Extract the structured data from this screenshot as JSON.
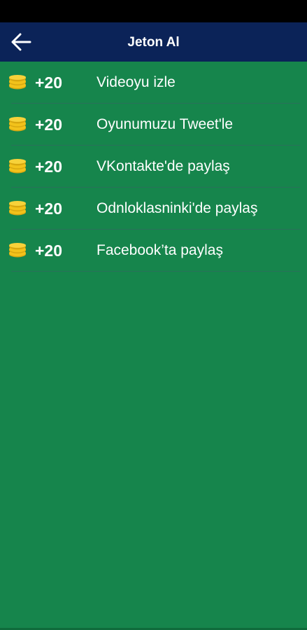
{
  "app_bar": {
    "title": "Jeton Al",
    "back_icon": "arrow-left-icon"
  },
  "rewards": [
    {
      "amount": "+20",
      "label": "Videoyu izle",
      "icon": "coin-stack-icon"
    },
    {
      "amount": "+20",
      "label": "Oyunumuzu Tweet'le",
      "icon": "coin-stack-icon"
    },
    {
      "amount": "+20",
      "label": "VKontakte'de paylaş",
      "icon": "coin-stack-icon"
    },
    {
      "amount": "+20",
      "label": "Odnloklasninki'de paylaş",
      "icon": "coin-stack-icon"
    },
    {
      "amount": "+20",
      "label": "Facebook’ta paylaş",
      "icon": "coin-stack-icon"
    }
  ],
  "colors": {
    "status_bar": "#000000",
    "app_bar": "#0b2358",
    "background": "#16854c",
    "coin": "#f2c21b",
    "divider": "#2a6f5a"
  }
}
